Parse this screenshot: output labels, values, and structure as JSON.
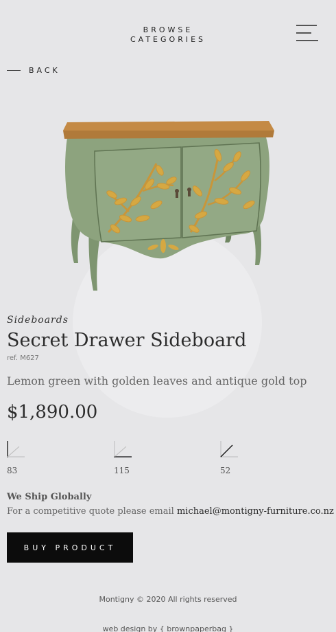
{
  "header": {
    "browse_line1": "BROWSE",
    "browse_line2": "CATEGORIES",
    "menu_icon": "hamburger-menu-icon"
  },
  "nav": {
    "back_label": "BACK"
  },
  "product": {
    "category": "Sideboards",
    "title": "Secret Drawer Sideboard",
    "ref": "ref. M627",
    "description": "Lemon green with golden leaves and antique gold top",
    "price": "$1,890.00",
    "image_subject": "green painted bombe sideboard with golden leaf motifs and wooden top"
  },
  "dimensions": [
    {
      "icon": "height-dimension-icon",
      "value": "83"
    },
    {
      "icon": "width-dimension-icon",
      "value": "115"
    },
    {
      "icon": "depth-dimension-icon",
      "value": "52"
    }
  ],
  "shipping": {
    "heading": "We Ship Globally",
    "text": "For a competitive quote please email ",
    "email": "michael@montigny-furniture.co.nz"
  },
  "actions": {
    "buy_label": "BUY PRODUCT"
  },
  "footer": {
    "copyright": "Montigny © 2020 All rights reserved",
    "credit": "web design by { brownpaperbag }"
  },
  "colors": {
    "background": "#e6e6e8",
    "button": "#0c0c0c",
    "cabinet_green": "#8da37e",
    "gold": "#d6a842",
    "wood_top": "#b07a3a"
  }
}
